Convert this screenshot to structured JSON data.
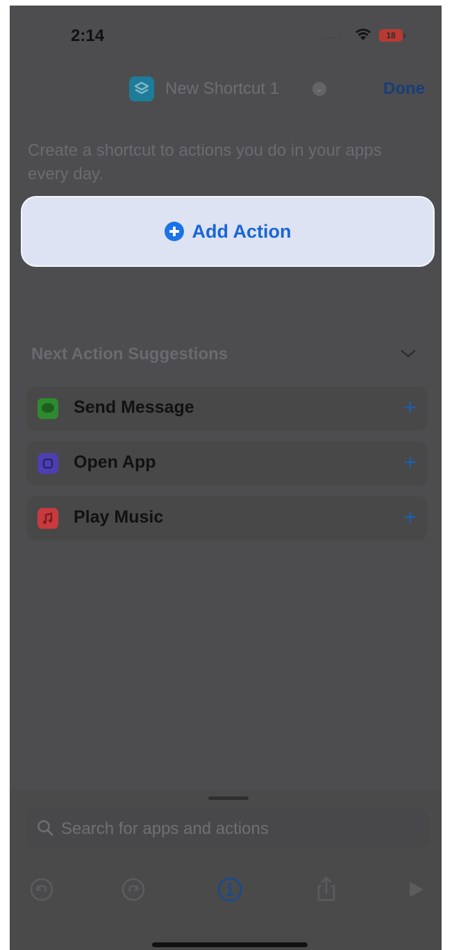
{
  "status_bar": {
    "time": "2:14",
    "signal_dots": "....",
    "battery": "18"
  },
  "nav": {
    "title": "New Shortcut 1",
    "done_label": "Done"
  },
  "description": "Create a shortcut to actions you do in your apps every day.",
  "add_action": {
    "label": "Add Action"
  },
  "suggestions": {
    "header": "Next Action Suggestions",
    "items": [
      {
        "label": "Send Message",
        "icon": "messages-icon",
        "color": "#2f8a2f"
      },
      {
        "label": "Open App",
        "icon": "open-app-icon",
        "color": "#4c3fb0"
      },
      {
        "label": "Play Music",
        "icon": "music-icon",
        "color": "#c83a3e"
      }
    ]
  },
  "search": {
    "placeholder": "Search for apps and actions"
  },
  "toolbar": {
    "items": [
      "undo-icon",
      "redo-icon",
      "info-icon",
      "share-icon",
      "play-icon"
    ]
  },
  "colors": {
    "accent": "#1a73e8",
    "overlay": "#4d4d4f",
    "highlight": "#dde3f2"
  }
}
